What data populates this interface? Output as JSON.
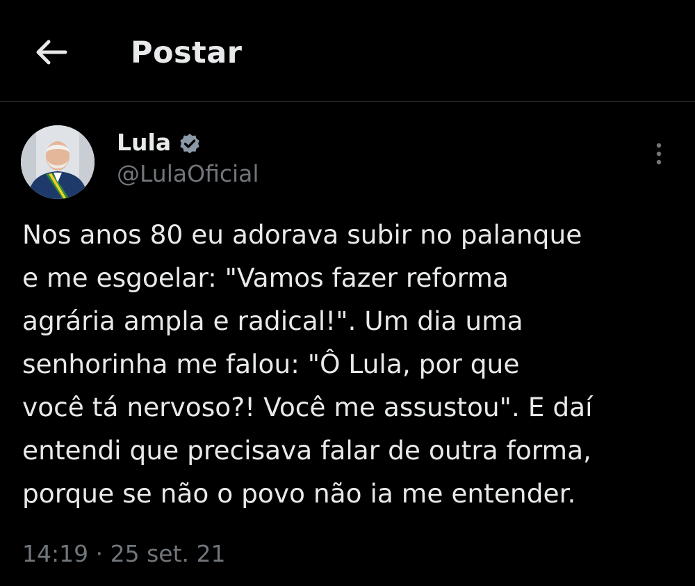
{
  "header": {
    "title": "Postar",
    "back_icon": "arrow-left-icon"
  },
  "post": {
    "author": {
      "name": "Lula",
      "handle": "@LulaOficial",
      "verified": true,
      "verified_icon": "verified-badge-icon",
      "verified_color": "#8b98a5"
    },
    "more_icon": "more-vertical-icon",
    "text": "Nos anos 80 eu adorava subir no palanque\ne me esgoelar: \"Vamos fazer reforma\nagrária ampla e radical!\". Um dia uma\nsenhorinha me falou: \"Ô Lula, por que\nvocê tá nervoso?! Você me assustou\". E daí\nentendi que precisava falar de outra forma,\nporque se não o povo não ia me entender.",
    "time": "14:19",
    "separator": "·",
    "date": "25 set. 21"
  },
  "colors": {
    "background": "#000000",
    "primary_text": "#e7e9ea",
    "secondary_text": "#71767b",
    "divider": "#2f3336"
  }
}
